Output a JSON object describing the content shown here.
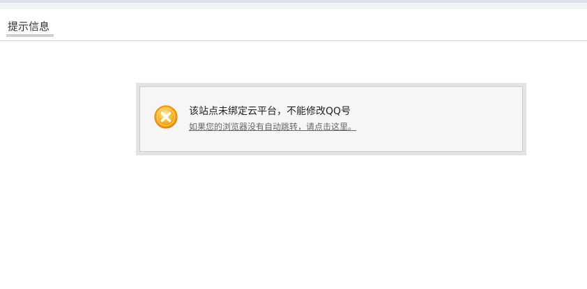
{
  "page": {
    "tab_title": "提示信息"
  },
  "message": {
    "icon": "error-x-icon",
    "title": "该站点未绑定云平台，不能修改QQ号",
    "redirect_link": "如果您的浏览器没有自动跳转，请点击这里。",
    "colors": {
      "icon_fill": "#f5a623",
      "icon_ring": "#e08a00"
    }
  }
}
